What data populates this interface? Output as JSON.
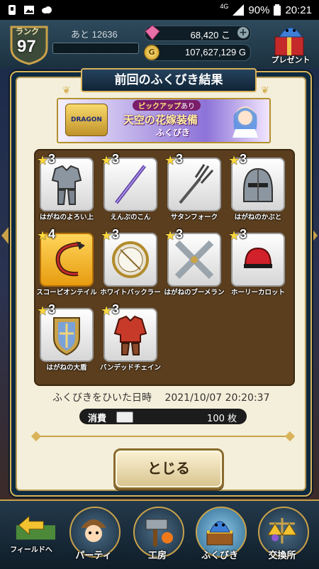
{
  "status_bar": {
    "network": "4G",
    "battery": "90%",
    "time": "20:21"
  },
  "header": {
    "rank_label": "ランク",
    "rank": "97",
    "exp_remaining": "あと 12636",
    "gems": "68,420 こ",
    "gold": "107,627,129 G",
    "gold_icon": "G",
    "present_label": "プレゼント"
  },
  "modal": {
    "title": "前回のふくびき結果",
    "banner": {
      "logo_text": "DRAGON QUEST V",
      "pickup": "ピックアップ",
      "pickup_suffix": "あり",
      "main": "天空の花嫁装備",
      "sub": "ふくびき"
    },
    "items": [
      {
        "rarity": "3",
        "name": "はがねのよろい上",
        "icon": "armor-icon",
        "gold": false
      },
      {
        "rarity": "3",
        "name": "えんぶのこん",
        "icon": "staff-icon",
        "gold": false
      },
      {
        "rarity": "3",
        "name": "サタンフォーク",
        "icon": "fork-icon",
        "gold": false
      },
      {
        "rarity": "3",
        "name": "はがねのかぶと",
        "icon": "helmet-icon",
        "gold": false
      },
      {
        "rarity": "4",
        "name": "スコーピオンテイル",
        "icon": "whip-icon",
        "gold": true
      },
      {
        "rarity": "3",
        "name": "ホワイトバックラー",
        "icon": "shield-round-icon",
        "gold": false
      },
      {
        "rarity": "3",
        "name": "はがねのブーメラン",
        "icon": "boomerang-icon",
        "gold": false
      },
      {
        "rarity": "3",
        "name": "ホーリーカロット",
        "icon": "cap-icon",
        "gold": false
      },
      {
        "rarity": "3",
        "name": "はがねの大盾",
        "icon": "great-shield-icon",
        "gold": false
      },
      {
        "rarity": "3",
        "name": "バンデッドチェイン",
        "icon": "chain-armor-icon",
        "gold": false
      }
    ],
    "drawn_at_label": "ふくびきをひいた日時",
    "drawn_at": "2021/10/07 20:20:37",
    "spend_label": "消費",
    "spend_amount": "100 枚",
    "close_label": "とじる"
  },
  "bottom_nav": [
    {
      "label": "フィールドへ",
      "icon": "field-arrow-icon"
    },
    {
      "label": "パーティ",
      "icon": "party-icon"
    },
    {
      "label": "工房",
      "icon": "workshop-icon"
    },
    {
      "label": "ふくびき",
      "icon": "lottery-icon"
    },
    {
      "label": "交換所",
      "icon": "exchange-icon"
    }
  ],
  "colors": {
    "accent_gold": "#d8b35a",
    "panel": "#f4efda",
    "grid_bg": "#5a3e1e"
  }
}
